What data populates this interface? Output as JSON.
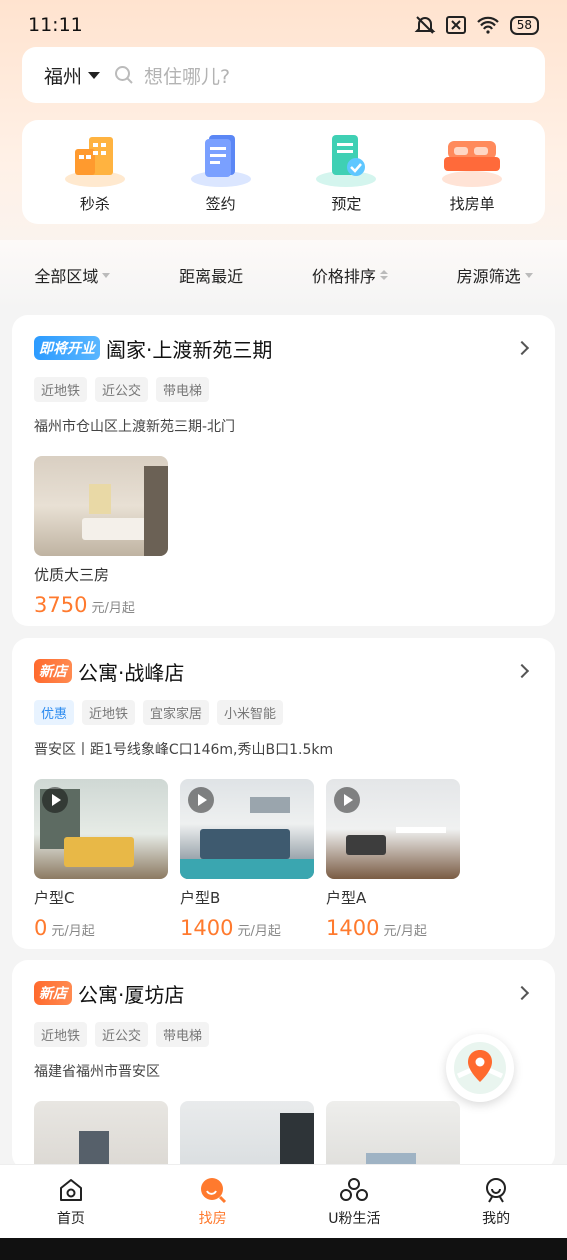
{
  "status_bar": {
    "time": "11:11",
    "battery": "58"
  },
  "search": {
    "city": "福州",
    "placeholder": "想住哪儿?"
  },
  "quick_actions": [
    {
      "label": "秒杀",
      "icon": "building-icon"
    },
    {
      "label": "签约",
      "icon": "contract-icon"
    },
    {
      "label": "预定",
      "icon": "reserve-icon"
    },
    {
      "label": "找房单",
      "icon": "bed-icon"
    }
  ],
  "filters": [
    {
      "label": "全部区域"
    },
    {
      "label": "距离最近"
    },
    {
      "label": "价格排序"
    },
    {
      "label": "房源筛选"
    }
  ],
  "listings": [
    {
      "badge": "即将开业",
      "title": "阖家·上渡新苑三期",
      "tags": [
        "近地铁",
        "近公交",
        "带电梯"
      ],
      "address": "福州市仓山区上渡新苑三期-北门",
      "rooms": [
        {
          "name": "优质大三房",
          "price": "3750",
          "unit": "元/月起"
        }
      ]
    },
    {
      "badge": "新店",
      "title": "公寓·战峰店",
      "tags": [
        "优惠",
        "近地铁",
        "宜家家居",
        "小米智能"
      ],
      "address": "晋安区丨距1号线象峰C口146m,秀山B口1.5km",
      "rooms": [
        {
          "name": "户型C",
          "price": "0",
          "unit": "元/月起"
        },
        {
          "name": "户型B",
          "price": "1400",
          "unit": "元/月起"
        },
        {
          "name": "户型A",
          "price": "1400",
          "unit": "元/月起"
        }
      ]
    },
    {
      "badge": "新店",
      "title": "公寓·厦坊店",
      "tags": [
        "近地铁",
        "近公交",
        "带电梯"
      ],
      "address": "福建省福州市晋安区",
      "rooms": []
    }
  ],
  "tabbar": [
    {
      "label": "首页"
    },
    {
      "label": "找房"
    },
    {
      "label": "U粉生活"
    },
    {
      "label": "我的"
    }
  ],
  "colors": {
    "accent": "#ff7a2e",
    "badge_blue": "#2c9bff",
    "badge_orange": "#ff6a2e"
  }
}
